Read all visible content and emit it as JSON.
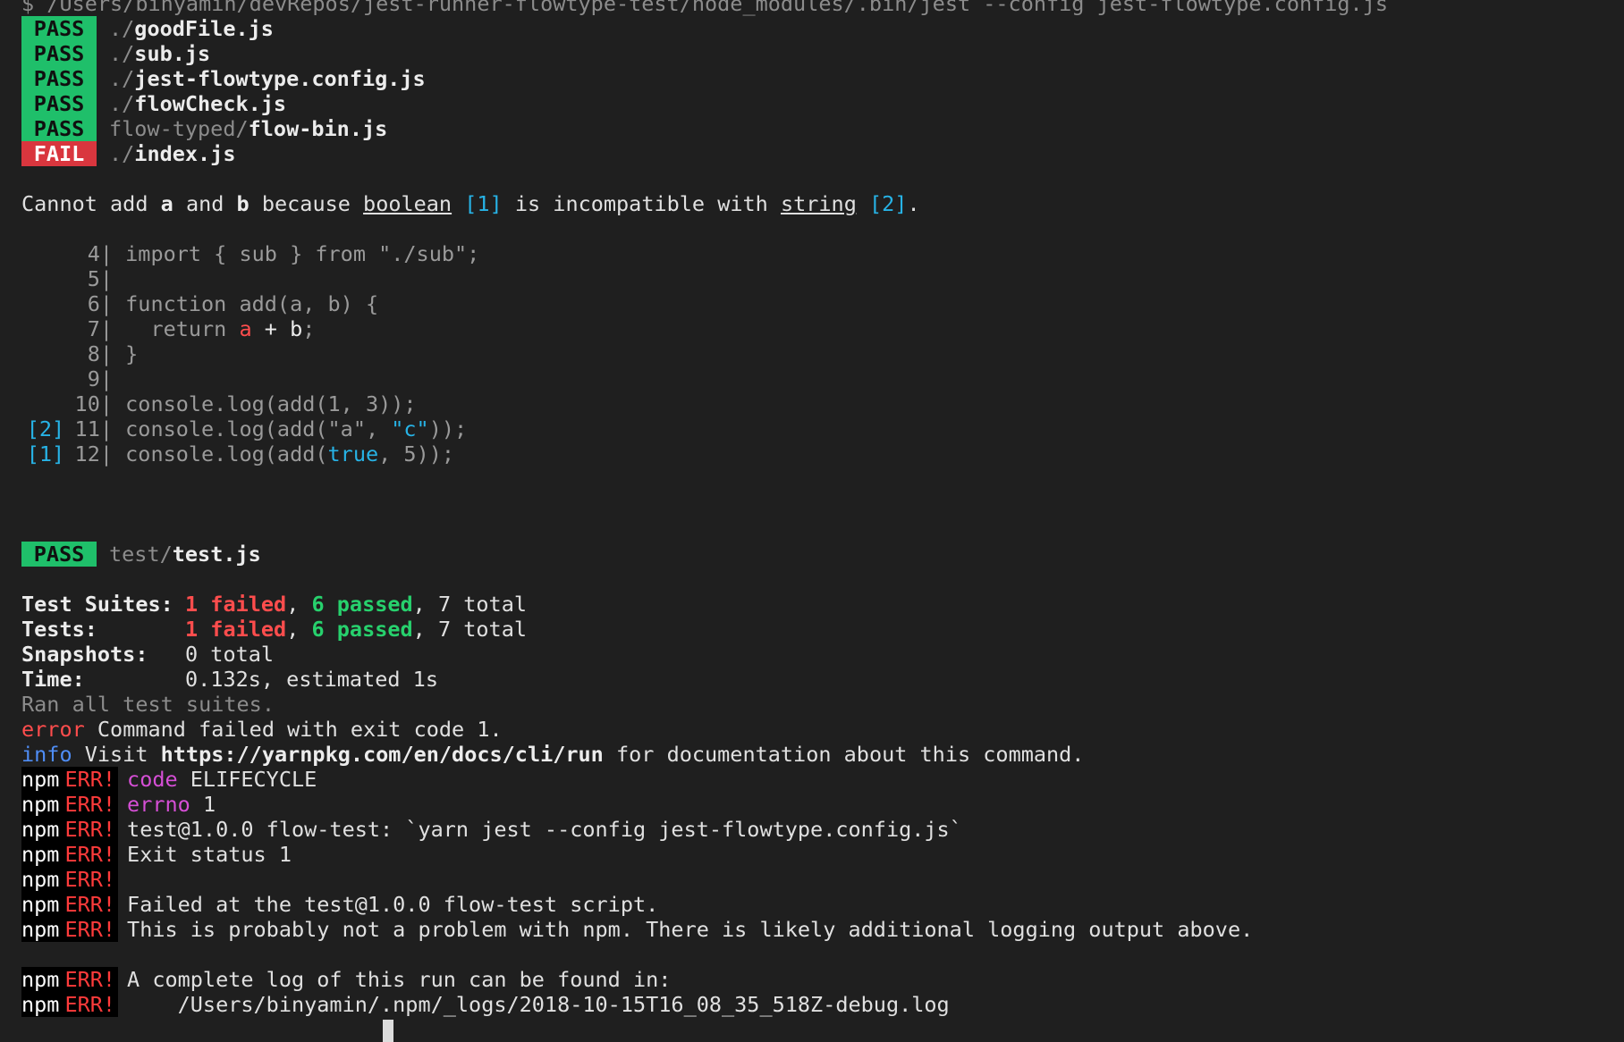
{
  "prompt": "$ /Users/binyamin/devRepos/jest-runner-flowtype-test/node_modules/.bin/jest --config jest-flowtype.config.js",
  "results": [
    {
      "status": "PASS",
      "dir": "./",
      "file": "goodFile.js"
    },
    {
      "status": "PASS",
      "dir": "./",
      "file": "sub.js"
    },
    {
      "status": "PASS",
      "dir": "./",
      "file": "jest-flowtype.config.js"
    },
    {
      "status": "PASS",
      "dir": "./",
      "file": "flowCheck.js"
    },
    {
      "status": "PASS",
      "dir": "flow-typed/",
      "file": "flow-bin.js"
    },
    {
      "status": "FAIL",
      "dir": "./",
      "file": "index.js"
    }
  ],
  "error_message": {
    "p1": "Cannot add ",
    "a": "a",
    "p2": " and ",
    "b": "b",
    "p3": " because ",
    "boolean": "boolean",
    "ref1": "[1]",
    "p4": " is incompatible with ",
    "string": "string",
    "ref2": "[2]",
    "p5": "."
  },
  "code": {
    "l4": {
      "num": "4|",
      "text": " import { sub } from \"./sub\";"
    },
    "l5": {
      "num": "5|"
    },
    "l6": {
      "num": "6|",
      "text": " function add(a, b) {"
    },
    "l7": {
      "num": "7|",
      "pre": "   return ",
      "hl": "a",
      "mid": " + ",
      "b": "b",
      "post": ";"
    },
    "l8": {
      "num": "8|",
      "text": " }"
    },
    "l9": {
      "num": "9|"
    },
    "l10": {
      "num": "10|",
      "text": " console.log(add(1, 3));"
    },
    "l11": {
      "ref": "[2]",
      "num": "11|",
      "pre": " console.log(add(\"a\", ",
      "hl": "\"c\"",
      "post": "));"
    },
    "l12": {
      "ref": "[1]",
      "num": "12|",
      "pre": " console.log(add(",
      "hl": "true",
      "post": ", 5));"
    }
  },
  "test_result": {
    "status": "PASS",
    "dir": "test/",
    "file": "test.js"
  },
  "summary": {
    "suites_label": "Test Suites:",
    "tests_label": "Tests:",
    "snapshots_label": "Snapshots:",
    "time_label": "Time:",
    "failed": "1 failed",
    "passed": "6 passed",
    "total": ", 7 total",
    "sep": ", ",
    "snapshots_value": "0 total",
    "time_value": "0.132s, estimated 1s",
    "ran": "Ran all test suites."
  },
  "yarn": {
    "error_tag": "error",
    "error_text": " Command failed with exit code 1.",
    "info_tag": "info",
    "info_pre": " Visit ",
    "info_url": "https://yarnpkg.com/en/docs/cli/run",
    "info_post": " for documentation about this command."
  },
  "npm": {
    "prefix": "npm",
    "err": "ERR!",
    "code_key": "code",
    "code_val": " ELIFECYCLE",
    "errno_key": "errno",
    "errno_val": " 1",
    "line3": "test@1.0.0 flow-test: `yarn jest --config jest-flowtype.config.js`",
    "line4": "Exit status 1",
    "line6": "Failed at the test@1.0.0 flow-test script.",
    "line7": "This is probably not a problem with npm. There is likely additional logging output above.",
    "line8": "A complete log of this run can be found in:",
    "line9": "    /Users/binyamin/.npm/_logs/2018-10-15T16_08_35_518Z-debug.log"
  }
}
